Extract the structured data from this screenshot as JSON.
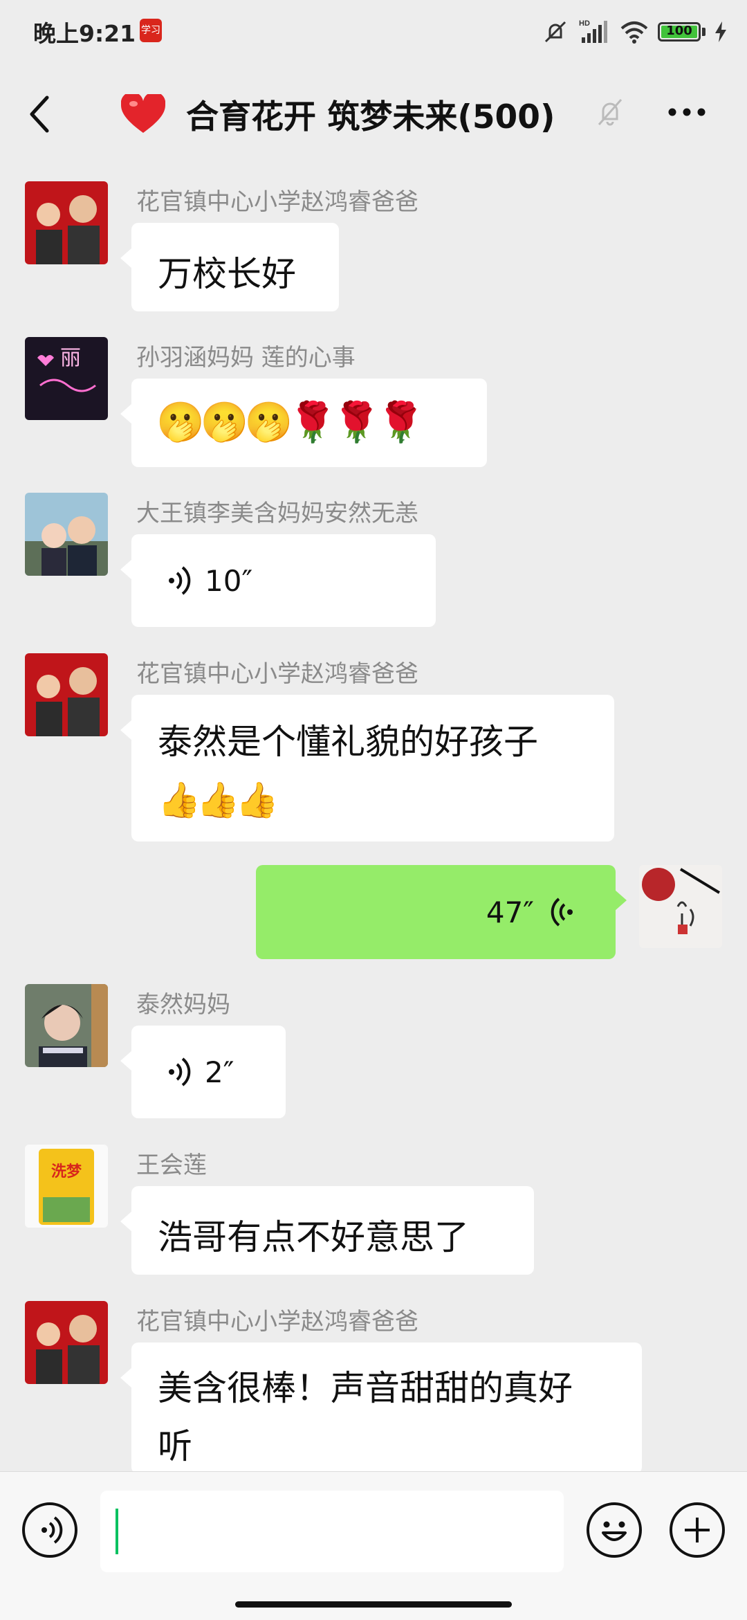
{
  "status_bar": {
    "time": "晚上9:21",
    "app_badge": "学习",
    "battery": "100"
  },
  "header": {
    "title": "合育花开 筑梦未来(500)"
  },
  "messages": [
    {
      "sender": "花官镇中心小学赵鸿睿爸爸",
      "text": "万校长好"
    },
    {
      "sender": "孙羽涵妈妈  莲的心事",
      "text": "🫢🫢🫢🌹🌹🌹"
    },
    {
      "sender": "大王镇李美含妈妈安然无恙",
      "voice": "10″"
    },
    {
      "sender": "花官镇中心小学赵鸿睿爸爸",
      "text_line1": "泰然是个懂礼貌的好孩子",
      "text_line2": "👍👍👍"
    },
    {
      "sender": "",
      "voice": "47″",
      "mine": true
    },
    {
      "sender": "泰然妈妈",
      "voice": "2″"
    },
    {
      "sender": "王会莲",
      "text": "浩哥有点不好意思了"
    },
    {
      "sender": "花官镇中心小学赵鸿睿爸爸",
      "text_line1": "美含很棒！声音甜甜的真好",
      "text_line2": "听"
    }
  ],
  "avatars": {
    "avatar2_text": "丽",
    "avatar7_text": "洗梦"
  },
  "colors": {
    "my_bubble": "#95ec69",
    "background": "#ededed",
    "cursor": "#07c160"
  }
}
